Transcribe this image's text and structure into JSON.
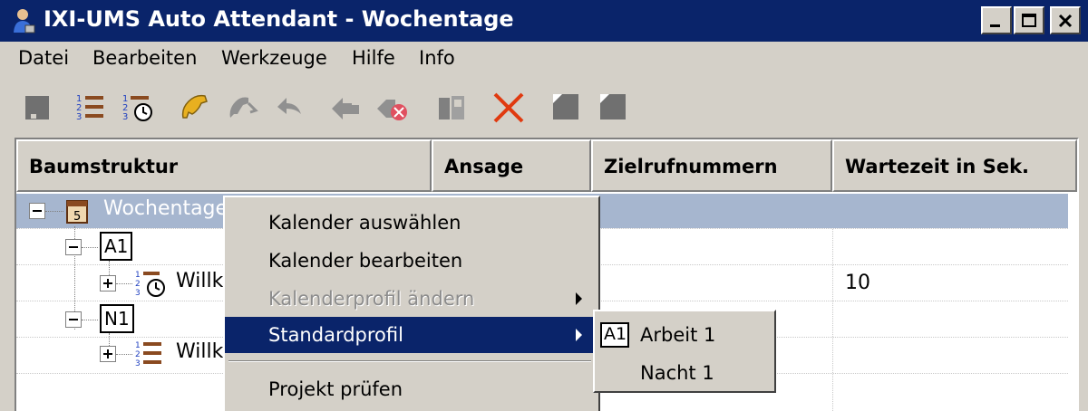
{
  "window": {
    "title": "IXI-UMS Auto Attendant - Wochentage"
  },
  "menubar": {
    "items": [
      "Datei",
      "Bearbeiten",
      "Werkzeuge",
      "Hilfe",
      "Info"
    ]
  },
  "toolbar": {
    "icons": [
      "save-icon",
      "list-icon",
      "schedule-icon",
      "phone-icon",
      "phone-forward-icon",
      "back-arrow-icon",
      "transfer-icon",
      "disconnect-icon",
      "columns-icon",
      "delete-icon",
      "square-icon",
      "square-icon"
    ]
  },
  "tree": {
    "columns": [
      "Baumstruktur",
      "Ansage",
      "Zielrufnummern",
      "Wartezeit in Sek."
    ],
    "root_label": "Wochentage",
    "node_a1": "A1",
    "node_a1_child": "Willk",
    "node_a1_child_wait": "10",
    "node_n1": "N1",
    "node_n1_child": "Willk"
  },
  "context_menu": {
    "items": [
      {
        "label": "Kalender auswählen",
        "state": "normal"
      },
      {
        "label": "Kalender bearbeiten",
        "state": "normal"
      },
      {
        "label": "Kalenderprofil ändern",
        "state": "disabled"
      },
      {
        "label": "Standardprofil",
        "state": "highlighted"
      },
      {
        "label": "Projekt prüfen",
        "state": "normal"
      }
    ]
  },
  "submenu": {
    "checked_box": "A1",
    "items": [
      "Arbeit 1",
      "Nacht 1"
    ]
  },
  "colors": {
    "titlebar": "#0a246a",
    "selection": "#a6b6cf",
    "menu_highlight": "#0a246a",
    "delete_icon": "#e03a10"
  }
}
